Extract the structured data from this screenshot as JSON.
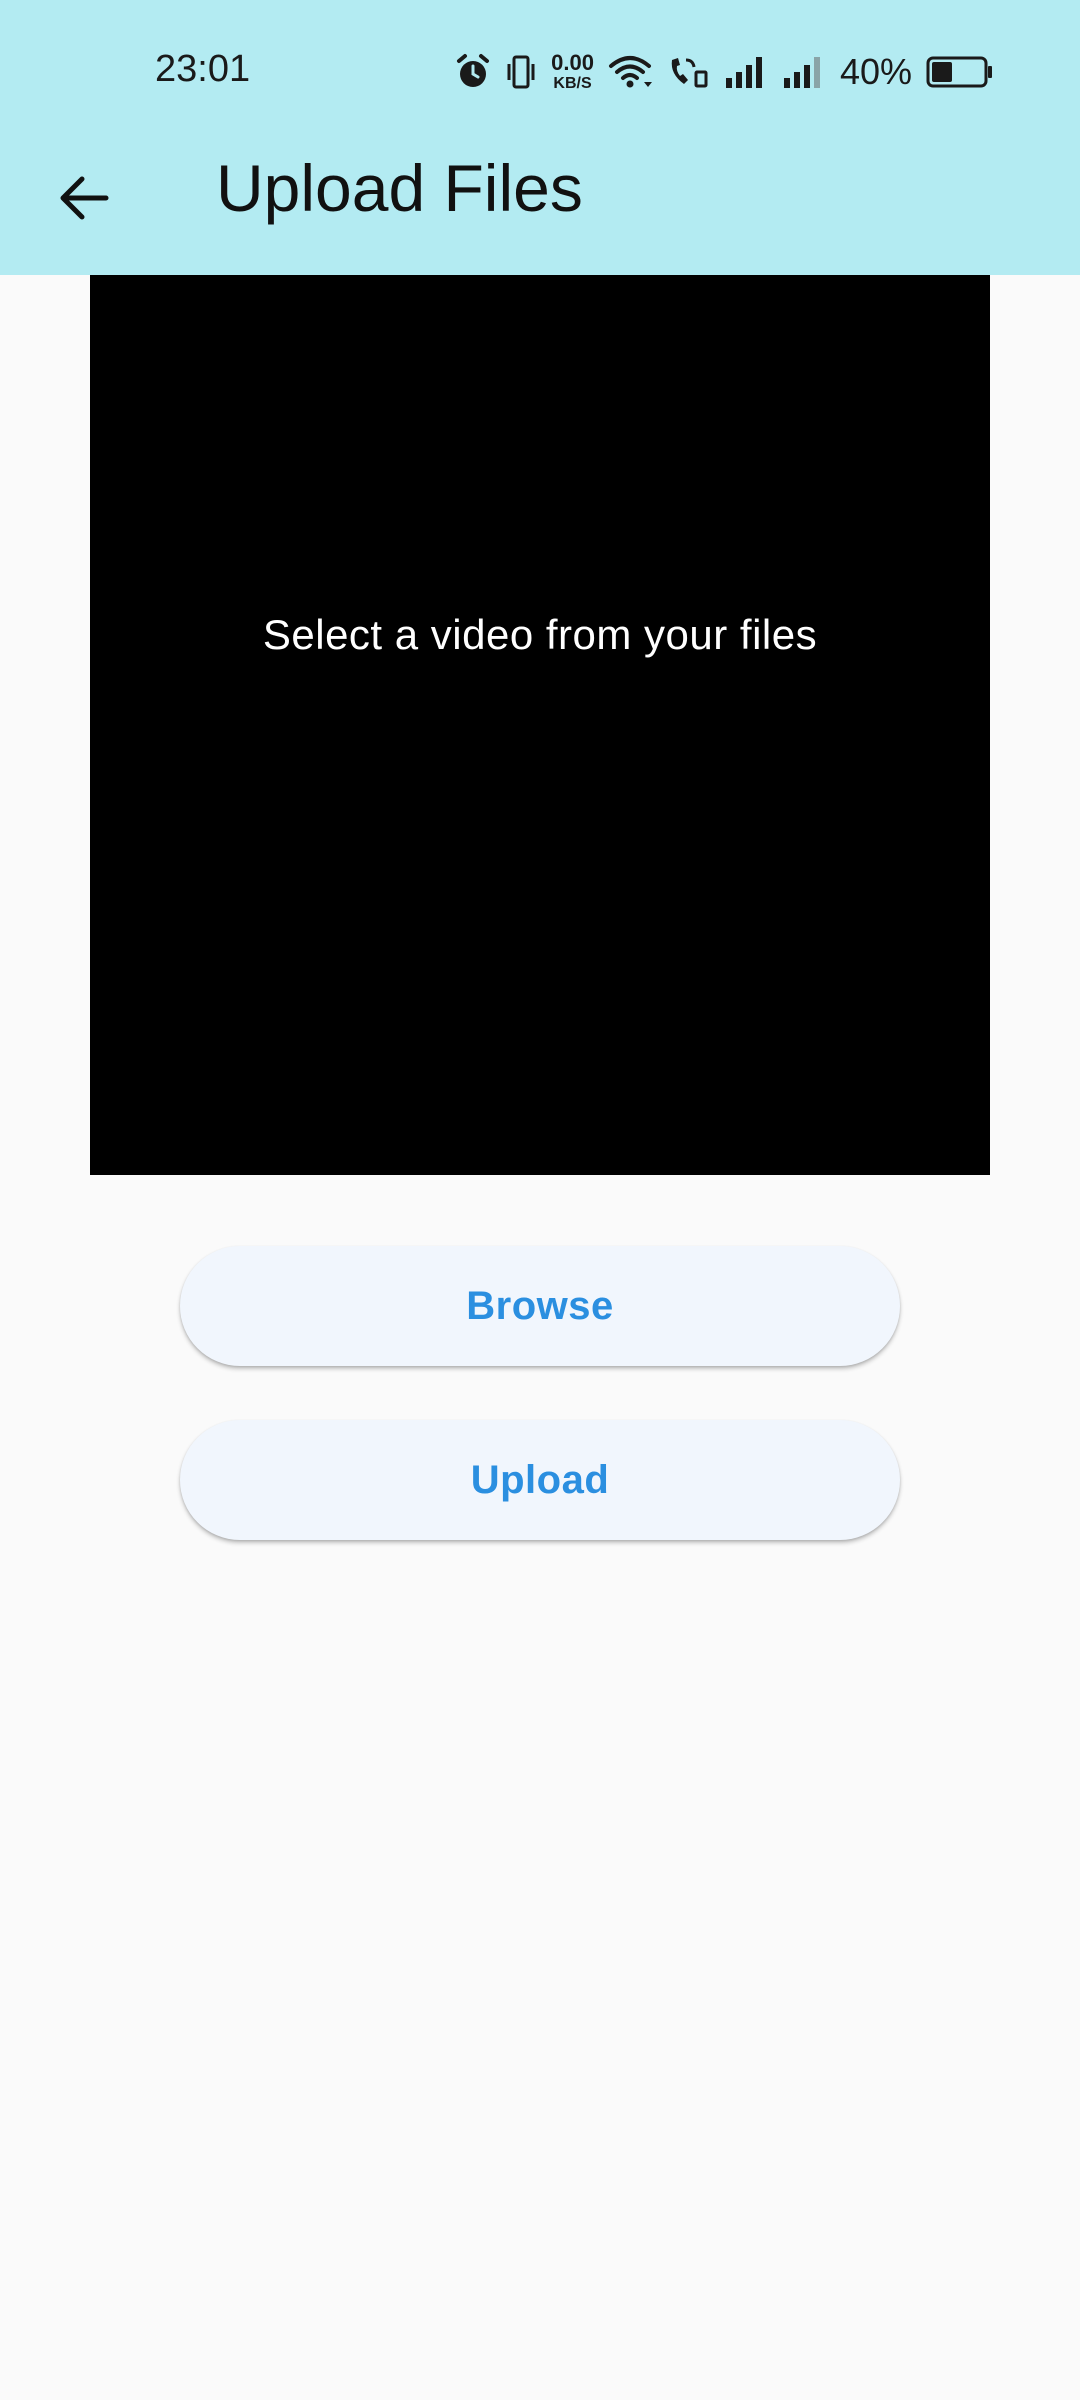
{
  "status_bar": {
    "time": "23:01",
    "net_speed_value": "0.00",
    "net_speed_unit": "KB/S",
    "battery_percent": "40%",
    "icons": [
      "alarm-icon",
      "vibrate-icon",
      "wifi-icon",
      "wifi-calling-icon",
      "signal-icon",
      "signal-icon",
      "battery-icon"
    ],
    "battery_level": 0.4
  },
  "app_bar": {
    "back_icon": "arrow-left-icon",
    "title": "Upload Files",
    "background_color": "#b3ebf2"
  },
  "video_preview": {
    "hint": "Select a video from your files"
  },
  "actions": {
    "browse_label": "Browse",
    "upload_label": "Upload",
    "accent_color": "#2b8fe0"
  }
}
